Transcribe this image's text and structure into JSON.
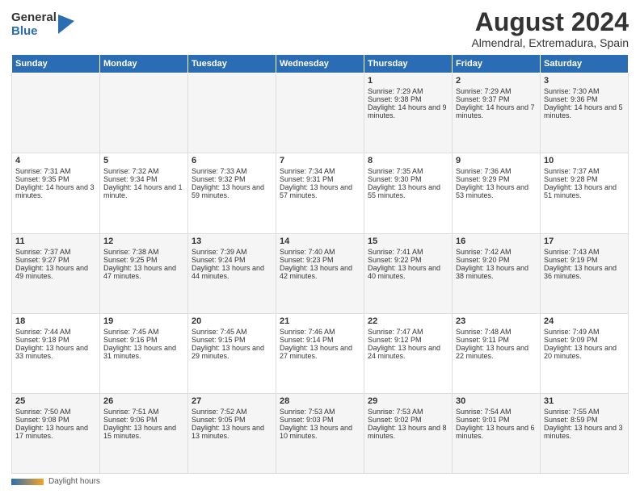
{
  "header": {
    "logo_general": "General",
    "logo_blue": "Blue",
    "month_title": "August 2024",
    "location": "Almendral, Extremadura, Spain"
  },
  "weekdays": [
    "Sunday",
    "Monday",
    "Tuesday",
    "Wednesday",
    "Thursday",
    "Friday",
    "Saturday"
  ],
  "weeks": [
    [
      {
        "day": "",
        "sunrise": "",
        "sunset": "",
        "daylight": ""
      },
      {
        "day": "",
        "sunrise": "",
        "sunset": "",
        "daylight": ""
      },
      {
        "day": "",
        "sunrise": "",
        "sunset": "",
        "daylight": ""
      },
      {
        "day": "",
        "sunrise": "",
        "sunset": "",
        "daylight": ""
      },
      {
        "day": "1",
        "sunrise": "Sunrise: 7:29 AM",
        "sunset": "Sunset: 9:38 PM",
        "daylight": "Daylight: 14 hours and 9 minutes."
      },
      {
        "day": "2",
        "sunrise": "Sunrise: 7:29 AM",
        "sunset": "Sunset: 9:37 PM",
        "daylight": "Daylight: 14 hours and 7 minutes."
      },
      {
        "day": "3",
        "sunrise": "Sunrise: 7:30 AM",
        "sunset": "Sunset: 9:36 PM",
        "daylight": "Daylight: 14 hours and 5 minutes."
      }
    ],
    [
      {
        "day": "4",
        "sunrise": "Sunrise: 7:31 AM",
        "sunset": "Sunset: 9:35 PM",
        "daylight": "Daylight: 14 hours and 3 minutes."
      },
      {
        "day": "5",
        "sunrise": "Sunrise: 7:32 AM",
        "sunset": "Sunset: 9:34 PM",
        "daylight": "Daylight: 14 hours and 1 minute."
      },
      {
        "day": "6",
        "sunrise": "Sunrise: 7:33 AM",
        "sunset": "Sunset: 9:32 PM",
        "daylight": "Daylight: 13 hours and 59 minutes."
      },
      {
        "day": "7",
        "sunrise": "Sunrise: 7:34 AM",
        "sunset": "Sunset: 9:31 PM",
        "daylight": "Daylight: 13 hours and 57 minutes."
      },
      {
        "day": "8",
        "sunrise": "Sunrise: 7:35 AM",
        "sunset": "Sunset: 9:30 PM",
        "daylight": "Daylight: 13 hours and 55 minutes."
      },
      {
        "day": "9",
        "sunrise": "Sunrise: 7:36 AM",
        "sunset": "Sunset: 9:29 PM",
        "daylight": "Daylight: 13 hours and 53 minutes."
      },
      {
        "day": "10",
        "sunrise": "Sunrise: 7:37 AM",
        "sunset": "Sunset: 9:28 PM",
        "daylight": "Daylight: 13 hours and 51 minutes."
      }
    ],
    [
      {
        "day": "11",
        "sunrise": "Sunrise: 7:37 AM",
        "sunset": "Sunset: 9:27 PM",
        "daylight": "Daylight: 13 hours and 49 minutes."
      },
      {
        "day": "12",
        "sunrise": "Sunrise: 7:38 AM",
        "sunset": "Sunset: 9:25 PM",
        "daylight": "Daylight: 13 hours and 47 minutes."
      },
      {
        "day": "13",
        "sunrise": "Sunrise: 7:39 AM",
        "sunset": "Sunset: 9:24 PM",
        "daylight": "Daylight: 13 hours and 44 minutes."
      },
      {
        "day": "14",
        "sunrise": "Sunrise: 7:40 AM",
        "sunset": "Sunset: 9:23 PM",
        "daylight": "Daylight: 13 hours and 42 minutes."
      },
      {
        "day": "15",
        "sunrise": "Sunrise: 7:41 AM",
        "sunset": "Sunset: 9:22 PM",
        "daylight": "Daylight: 13 hours and 40 minutes."
      },
      {
        "day": "16",
        "sunrise": "Sunrise: 7:42 AM",
        "sunset": "Sunset: 9:20 PM",
        "daylight": "Daylight: 13 hours and 38 minutes."
      },
      {
        "day": "17",
        "sunrise": "Sunrise: 7:43 AM",
        "sunset": "Sunset: 9:19 PM",
        "daylight": "Daylight: 13 hours and 36 minutes."
      }
    ],
    [
      {
        "day": "18",
        "sunrise": "Sunrise: 7:44 AM",
        "sunset": "Sunset: 9:18 PM",
        "daylight": "Daylight: 13 hours and 33 minutes."
      },
      {
        "day": "19",
        "sunrise": "Sunrise: 7:45 AM",
        "sunset": "Sunset: 9:16 PM",
        "daylight": "Daylight: 13 hours and 31 minutes."
      },
      {
        "day": "20",
        "sunrise": "Sunrise: 7:45 AM",
        "sunset": "Sunset: 9:15 PM",
        "daylight": "Daylight: 13 hours and 29 minutes."
      },
      {
        "day": "21",
        "sunrise": "Sunrise: 7:46 AM",
        "sunset": "Sunset: 9:14 PM",
        "daylight": "Daylight: 13 hours and 27 minutes."
      },
      {
        "day": "22",
        "sunrise": "Sunrise: 7:47 AM",
        "sunset": "Sunset: 9:12 PM",
        "daylight": "Daylight: 13 hours and 24 minutes."
      },
      {
        "day": "23",
        "sunrise": "Sunrise: 7:48 AM",
        "sunset": "Sunset: 9:11 PM",
        "daylight": "Daylight: 13 hours and 22 minutes."
      },
      {
        "day": "24",
        "sunrise": "Sunrise: 7:49 AM",
        "sunset": "Sunset: 9:09 PM",
        "daylight": "Daylight: 13 hours and 20 minutes."
      }
    ],
    [
      {
        "day": "25",
        "sunrise": "Sunrise: 7:50 AM",
        "sunset": "Sunset: 9:08 PM",
        "daylight": "Daylight: 13 hours and 17 minutes."
      },
      {
        "day": "26",
        "sunrise": "Sunrise: 7:51 AM",
        "sunset": "Sunset: 9:06 PM",
        "daylight": "Daylight: 13 hours and 15 minutes."
      },
      {
        "day": "27",
        "sunrise": "Sunrise: 7:52 AM",
        "sunset": "Sunset: 9:05 PM",
        "daylight": "Daylight: 13 hours and 13 minutes."
      },
      {
        "day": "28",
        "sunrise": "Sunrise: 7:53 AM",
        "sunset": "Sunset: 9:03 PM",
        "daylight": "Daylight: 13 hours and 10 minutes."
      },
      {
        "day": "29",
        "sunrise": "Sunrise: 7:53 AM",
        "sunset": "Sunset: 9:02 PM",
        "daylight": "Daylight: 13 hours and 8 minutes."
      },
      {
        "day": "30",
        "sunrise": "Sunrise: 7:54 AM",
        "sunset": "Sunset: 9:01 PM",
        "daylight": "Daylight: 13 hours and 6 minutes."
      },
      {
        "day": "31",
        "sunrise": "Sunrise: 7:55 AM",
        "sunset": "Sunset: 8:59 PM",
        "daylight": "Daylight: 13 hours and 3 minutes."
      }
    ]
  ],
  "footer": {
    "daylight_label": "Daylight hours"
  }
}
